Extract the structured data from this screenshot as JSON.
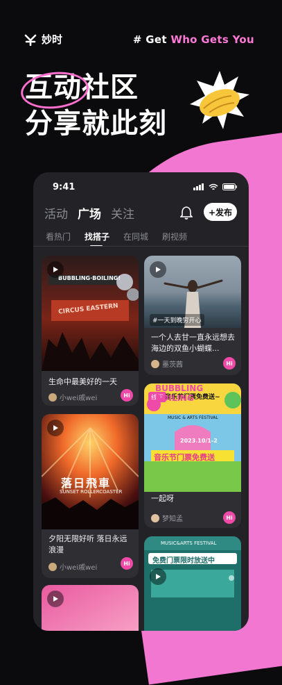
{
  "app": {
    "logo_text": "妙时",
    "tagline_prefix": "# Get ",
    "tagline_highlight": "Who Gets You"
  },
  "hero": {
    "line1": "互动社区",
    "line2": "分享就此刻",
    "badge_icon": "handshake-icon"
  },
  "phone": {
    "status_time": "9:41",
    "tabs": [
      "活动",
      "广场",
      "关注"
    ],
    "active_tab": "广场",
    "post_label": "+发布",
    "subtabs": [
      "看热门",
      "找搭子",
      "在同城",
      "刷视频"
    ],
    "active_subtab": "找搭子"
  },
  "feed": {
    "left": [
      {
        "title": "生命中最美好的一天",
        "user": "小wei戚wei",
        "image_text": "BUBBLING·BOILING!",
        "banner_text": "CIRCUS EASTERN"
      },
      {
        "title": "夕阳无限好听 落日永远浪漫",
        "user": "小wei戚wei",
        "image_text": "落日飛車",
        "image_sub": "SUNSET ROLLERCOASTER"
      },
      {
        "title": "",
        "user": ""
      }
    ],
    "right": [
      {
        "tag": "#一天到晚穷开心",
        "title": "一个人去甘一直永远想去海边的双鱼小蝴蝶...",
        "user": "墨茨茜"
      },
      {
        "badge": "线下",
        "title": "一起呀",
        "user": "梦知孟",
        "poster_head": "BUBBLING BOILING",
        "poster_sub": "MUSIC & ARTS FESTIVAL",
        "poster_date": "2023.10/1-2",
        "poster_banner": "音乐节门票免费送",
        "poster_overlay": "音乐节门票免费送~"
      },
      {
        "title": "",
        "user": "",
        "poster_head": "MUSIC&ARTS FESTIVAL",
        "poster_banner": "免费门票限时放送中"
      }
    ],
    "hi_label": "Hi"
  },
  "colors": {
    "accent_pink": "#f277d1",
    "hi_pink": "#ef4aa8",
    "background": "#0b0b0d",
    "phone_bg": "#232327"
  }
}
